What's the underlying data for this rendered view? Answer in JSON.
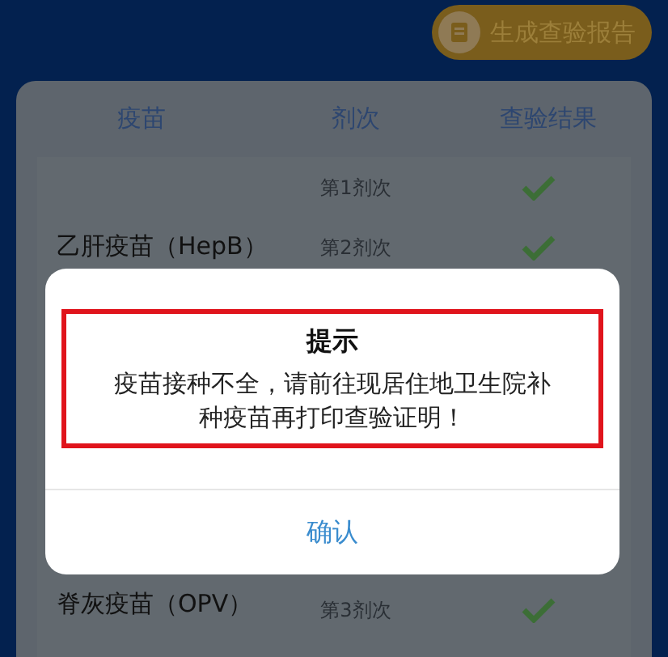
{
  "header_button": {
    "label": "生成查验报告"
  },
  "table": {
    "columns": [
      "疫苗",
      "剂次",
      "查验结果"
    ],
    "groups": [
      {
        "vaccine": "乙肝疫苗（HepB）",
        "rows": [
          {
            "dose": "第1剂次",
            "passed": true
          },
          {
            "dose": "第2剂次",
            "passed": true
          }
        ]
      },
      {
        "vaccine": "脊灰疫苗（OPV）",
        "rows": [
          {
            "dose": "第3剂次",
            "passed": true
          }
        ]
      }
    ]
  },
  "dialog": {
    "title": "提示",
    "message": "疫苗接种不全，请前往现居住地卫生院补种疫苗再打印查验证明！",
    "button": "确认"
  }
}
